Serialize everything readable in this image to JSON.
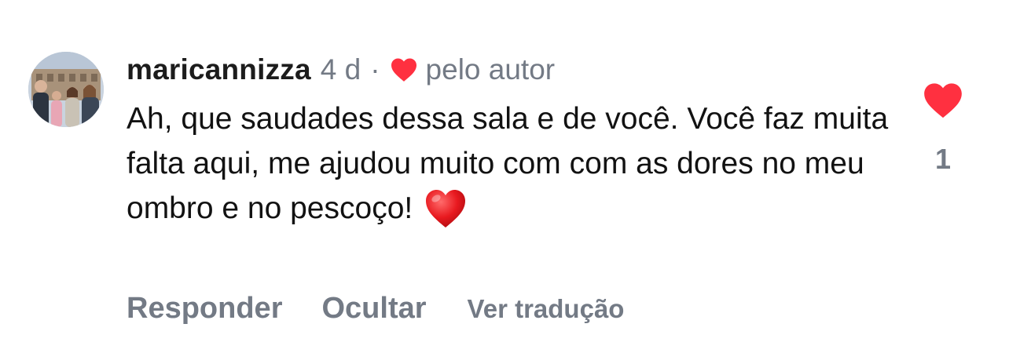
{
  "comment": {
    "username": "maricannizza",
    "time_ago": "4 d",
    "separator": "·",
    "author_label": "pelo autor",
    "text": "Ah, que saudades dessa sala e de você. Você faz muita falta aqui, me ajudou muito com com as dores no meu ombro e no pescoço!",
    "like_count": "1"
  },
  "actions": {
    "reply_label": "Responder",
    "hide_label": "Ocultar",
    "translate_label": "Ver tradução"
  },
  "icons": {
    "author_like": "heart-icon",
    "inline_emoji": "red-heart-emoji",
    "like_button": "heart-icon"
  },
  "colors": {
    "heart": "#ff3040",
    "secondary_text": "#737a85",
    "primary_text": "#121212"
  }
}
